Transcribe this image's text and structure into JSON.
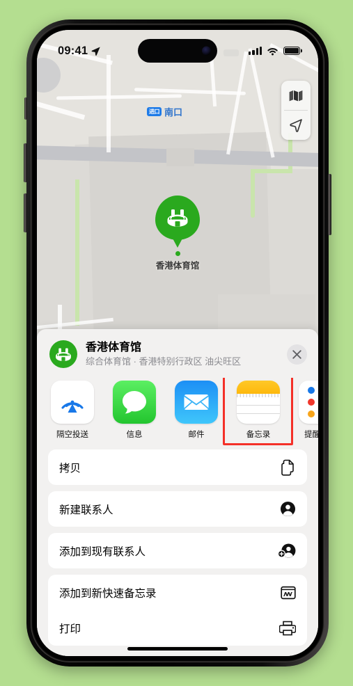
{
  "background_color": "#b4de90",
  "status_bar": {
    "time": "09:41",
    "location_arrow_icon": "location-arrow-icon",
    "cellular_icon": "cellular-signal-icon",
    "wifi_icon": "wifi-icon",
    "battery_icon": "battery-full-icon"
  },
  "map": {
    "label_badge": "进口",
    "label_text": "南口",
    "marker_label": "香港体育馆",
    "marker_icon": "stadium-icon",
    "marker_color": "#2aa91e",
    "controls": [
      {
        "name": "map-style-button",
        "icon": "folded-map-icon"
      },
      {
        "name": "current-location-button",
        "icon": "navigation-arrow-icon"
      }
    ]
  },
  "share_sheet": {
    "place_icon": "stadium-icon",
    "title": "香港体育馆",
    "subtitle": "综合体育馆 · 香港特别行政区 油尖旺区",
    "close_label": "✕",
    "apps": [
      {
        "label": "隔空投送",
        "icon": "airdrop-icon",
        "highlighted": false
      },
      {
        "label": "信息",
        "icon": "messages-icon",
        "highlighted": false
      },
      {
        "label": "邮件",
        "icon": "mail-icon",
        "highlighted": false
      },
      {
        "label": "备忘录",
        "icon": "notes-icon",
        "highlighted": true
      },
      {
        "label": "提醒事项",
        "icon": "reminders-icon",
        "highlighted": false
      }
    ],
    "highlight_color": "#f43028",
    "actions": [
      {
        "label": "拷贝",
        "icon": "copy-documents-icon"
      },
      {
        "label": "新建联系人",
        "icon": "person-circle-icon"
      },
      {
        "label": "添加到现有联系人",
        "icon": "person-add-icon"
      },
      {
        "label": "添加到新快速备忘录",
        "icon": "quick-note-icon"
      },
      {
        "label": "打印",
        "icon": "printer-icon"
      }
    ]
  }
}
